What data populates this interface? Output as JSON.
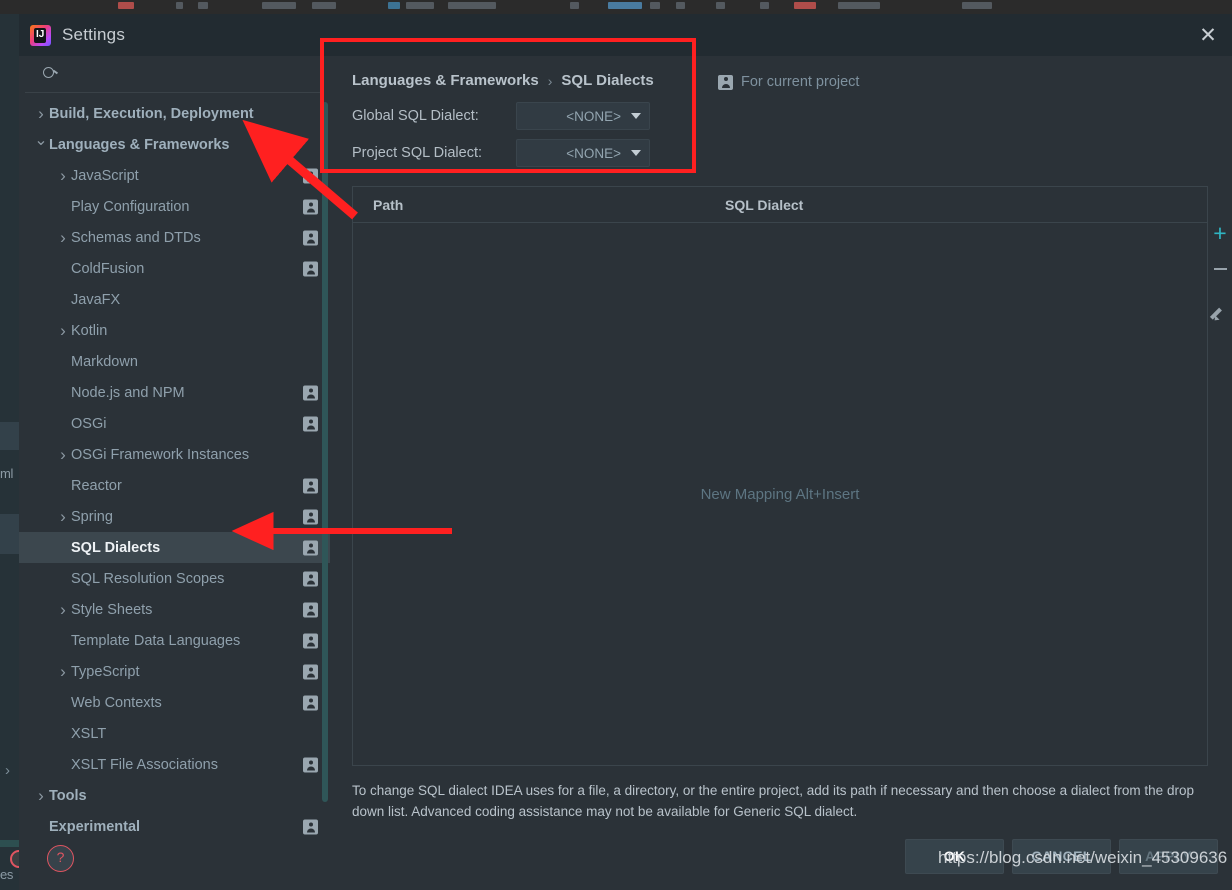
{
  "window": {
    "title": "Settings",
    "app_icon": "intellij-idea-icon",
    "close_label": "✕"
  },
  "sidebar": {
    "search": {
      "value": "",
      "placeholder": ""
    },
    "items": [
      {
        "label": "Build, Execution, Deployment",
        "level": 0,
        "chev": "closed",
        "badge": false,
        "selected": false
      },
      {
        "label": "Languages & Frameworks",
        "level": 0,
        "chev": "open",
        "badge": false,
        "selected": false
      },
      {
        "label": "JavaScript",
        "level": 1,
        "chev": "closed",
        "badge": true,
        "selected": false
      },
      {
        "label": "Play Configuration",
        "level": 1,
        "chev": "none",
        "badge": true,
        "selected": false
      },
      {
        "label": "Schemas and DTDs",
        "level": 1,
        "chev": "closed",
        "badge": true,
        "selected": false
      },
      {
        "label": "ColdFusion",
        "level": 1,
        "chev": "none",
        "badge": true,
        "selected": false
      },
      {
        "label": "JavaFX",
        "level": 1,
        "chev": "none",
        "badge": false,
        "selected": false
      },
      {
        "label": "Kotlin",
        "level": 1,
        "chev": "closed",
        "badge": false,
        "selected": false
      },
      {
        "label": "Markdown",
        "level": 1,
        "chev": "none",
        "badge": false,
        "selected": false
      },
      {
        "label": "Node.js and NPM",
        "level": 1,
        "chev": "none",
        "badge": true,
        "selected": false
      },
      {
        "label": "OSGi",
        "level": 1,
        "chev": "none",
        "badge": true,
        "selected": false
      },
      {
        "label": "OSGi Framework Instances",
        "level": 1,
        "chev": "closed",
        "badge": false,
        "selected": false
      },
      {
        "label": "Reactor",
        "level": 1,
        "chev": "none",
        "badge": true,
        "selected": false
      },
      {
        "label": "Spring",
        "level": 1,
        "chev": "closed",
        "badge": true,
        "selected": false
      },
      {
        "label": "SQL Dialects",
        "level": 1,
        "chev": "none",
        "badge": true,
        "selected": true
      },
      {
        "label": "SQL Resolution Scopes",
        "level": 1,
        "chev": "none",
        "badge": true,
        "selected": false
      },
      {
        "label": "Style Sheets",
        "level": 1,
        "chev": "closed",
        "badge": true,
        "selected": false
      },
      {
        "label": "Template Data Languages",
        "level": 1,
        "chev": "none",
        "badge": true,
        "selected": false
      },
      {
        "label": "TypeScript",
        "level": 1,
        "chev": "closed",
        "badge": true,
        "selected": false
      },
      {
        "label": "Web Contexts",
        "level": 1,
        "chev": "none",
        "badge": true,
        "selected": false
      },
      {
        "label": "XSLT",
        "level": 1,
        "chev": "none",
        "badge": false,
        "selected": false
      },
      {
        "label": "XSLT File Associations",
        "level": 1,
        "chev": "none",
        "badge": true,
        "selected": false
      },
      {
        "label": "Tools",
        "level": 0,
        "chev": "closed",
        "badge": false,
        "selected": false
      },
      {
        "label": "Experimental",
        "level": 0,
        "chev": "none",
        "badge": true,
        "selected": false
      }
    ],
    "help_icon": "question-mark-icon",
    "help_label": "?"
  },
  "main": {
    "breadcrumb": {
      "parent": "Languages & Frameworks",
      "separator": "›",
      "current": "SQL Dialects"
    },
    "for_current_project": {
      "icon": "project-scope-icon",
      "label": "For current project"
    },
    "global_dialect": {
      "label": "Global SQL Dialect:",
      "value": "<NONE>"
    },
    "project_dialect": {
      "label": "Project SQL Dialect:",
      "value": "<NONE>"
    },
    "table": {
      "columns": [
        "Path",
        "SQL Dialect"
      ],
      "rows": [],
      "empty_message": "New Mapping Alt+Insert"
    },
    "tools": [
      {
        "icon": "plus-icon",
        "name": "add-mapping-button",
        "color": "#2fb6c4"
      },
      {
        "icon": "minus-icon",
        "name": "remove-mapping-button",
        "color": "#98a3ab"
      },
      {
        "icon": "pencil-icon",
        "name": "edit-mapping-button",
        "color": "#98a3ab"
      }
    ],
    "hint": "To change SQL dialect IDEA uses for a file, a directory, or the entire project, add its path if necessary and then choose a dialect from the drop down list. Advanced coding assistance may not be available for Generic SQL dialect.",
    "buttons": {
      "ok": "OK",
      "cancel": "CANCEL",
      "apply": "APPLY"
    }
  },
  "background": {
    "left_text_1": "ml",
    "left_text_2": "es"
  },
  "annotations": {
    "highlight_color": "#ff2020",
    "watermark": "https://blog.csdn.net/weixin_45309636"
  }
}
